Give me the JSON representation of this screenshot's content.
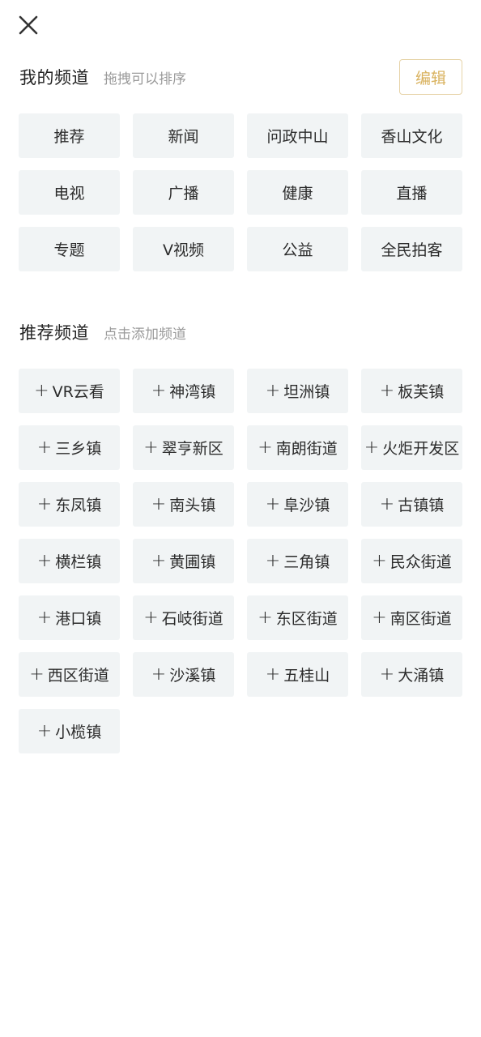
{
  "my_channels": {
    "title": "我的频道",
    "hint": "拖拽可以排序",
    "edit_label": "编辑",
    "items": [
      {
        "label": "推荐"
      },
      {
        "label": "新闻"
      },
      {
        "label": "问政中山"
      },
      {
        "label": "香山文化"
      },
      {
        "label": "电视"
      },
      {
        "label": "广播"
      },
      {
        "label": "健康"
      },
      {
        "label": "直播"
      },
      {
        "label": "专题"
      },
      {
        "label": "V视频"
      },
      {
        "label": "公益"
      },
      {
        "label": "全民拍客"
      }
    ]
  },
  "recommended_channels": {
    "title": "推荐频道",
    "hint": "点击添加频道",
    "add_symbol": "+",
    "items": [
      {
        "label": "VR云看"
      },
      {
        "label": "神湾镇"
      },
      {
        "label": "坦洲镇"
      },
      {
        "label": "板芙镇"
      },
      {
        "label": "三乡镇"
      },
      {
        "label": "翠亨新区"
      },
      {
        "label": "南朗街道"
      },
      {
        "label": "火炬开发区"
      },
      {
        "label": "东凤镇"
      },
      {
        "label": "南头镇"
      },
      {
        "label": "阜沙镇"
      },
      {
        "label": "古镇镇"
      },
      {
        "label": "横栏镇"
      },
      {
        "label": "黄圃镇"
      },
      {
        "label": "三角镇"
      },
      {
        "label": "民众街道"
      },
      {
        "label": "港口镇"
      },
      {
        "label": "石岐街道"
      },
      {
        "label": "东区街道"
      },
      {
        "label": "南区街道"
      },
      {
        "label": "西区街道"
      },
      {
        "label": "沙溪镇"
      },
      {
        "label": "五桂山"
      },
      {
        "label": "大涌镇"
      },
      {
        "label": "小榄镇"
      }
    ]
  },
  "colors": {
    "chip_bg": "#f1f4f5",
    "accent": "#d9b25e",
    "hint": "#9a9a9a"
  },
  "icons": {
    "close": "close-icon",
    "add": "plus-icon"
  }
}
